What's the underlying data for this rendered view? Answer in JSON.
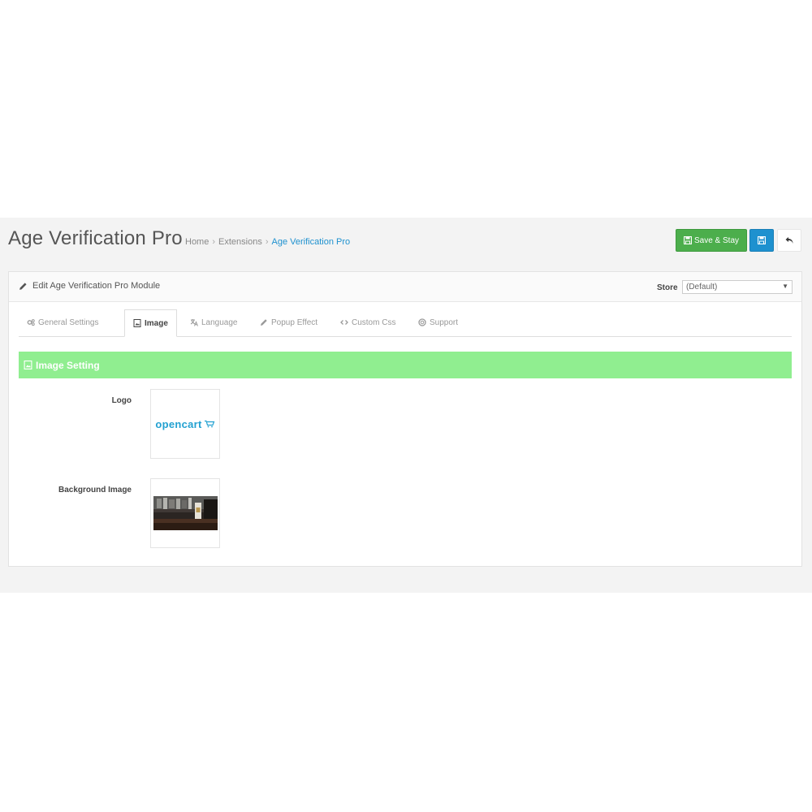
{
  "header": {
    "title": "Age Verification Pro",
    "breadcrumb": [
      "Home",
      "Extensions",
      "Age Verification Pro"
    ],
    "separator": "›",
    "save_stay_label": "Save & Stay"
  },
  "panel": {
    "title": "Edit Age Verification Pro Module",
    "store_label": "Store",
    "store_value": "(Default)"
  },
  "tabs": [
    {
      "label": "General Settings",
      "icon": "cogs-icon"
    },
    {
      "label": "Image",
      "icon": "image-icon",
      "active": true
    },
    {
      "label": "Language",
      "icon": "language-icon"
    },
    {
      "label": "Popup Effect",
      "icon": "pencil-icon"
    },
    {
      "label": "Custom Css",
      "icon": "code-icon"
    },
    {
      "label": "Support",
      "icon": "support-icon"
    }
  ],
  "section": {
    "title": "Image Setting"
  },
  "fields": {
    "logo_label": "Logo",
    "logo_text": "opencart",
    "background_label": "Background Image"
  },
  "colors": {
    "accent": "#1e91cf",
    "success": "#4cae4c",
    "section_bar": "#90ee90"
  }
}
